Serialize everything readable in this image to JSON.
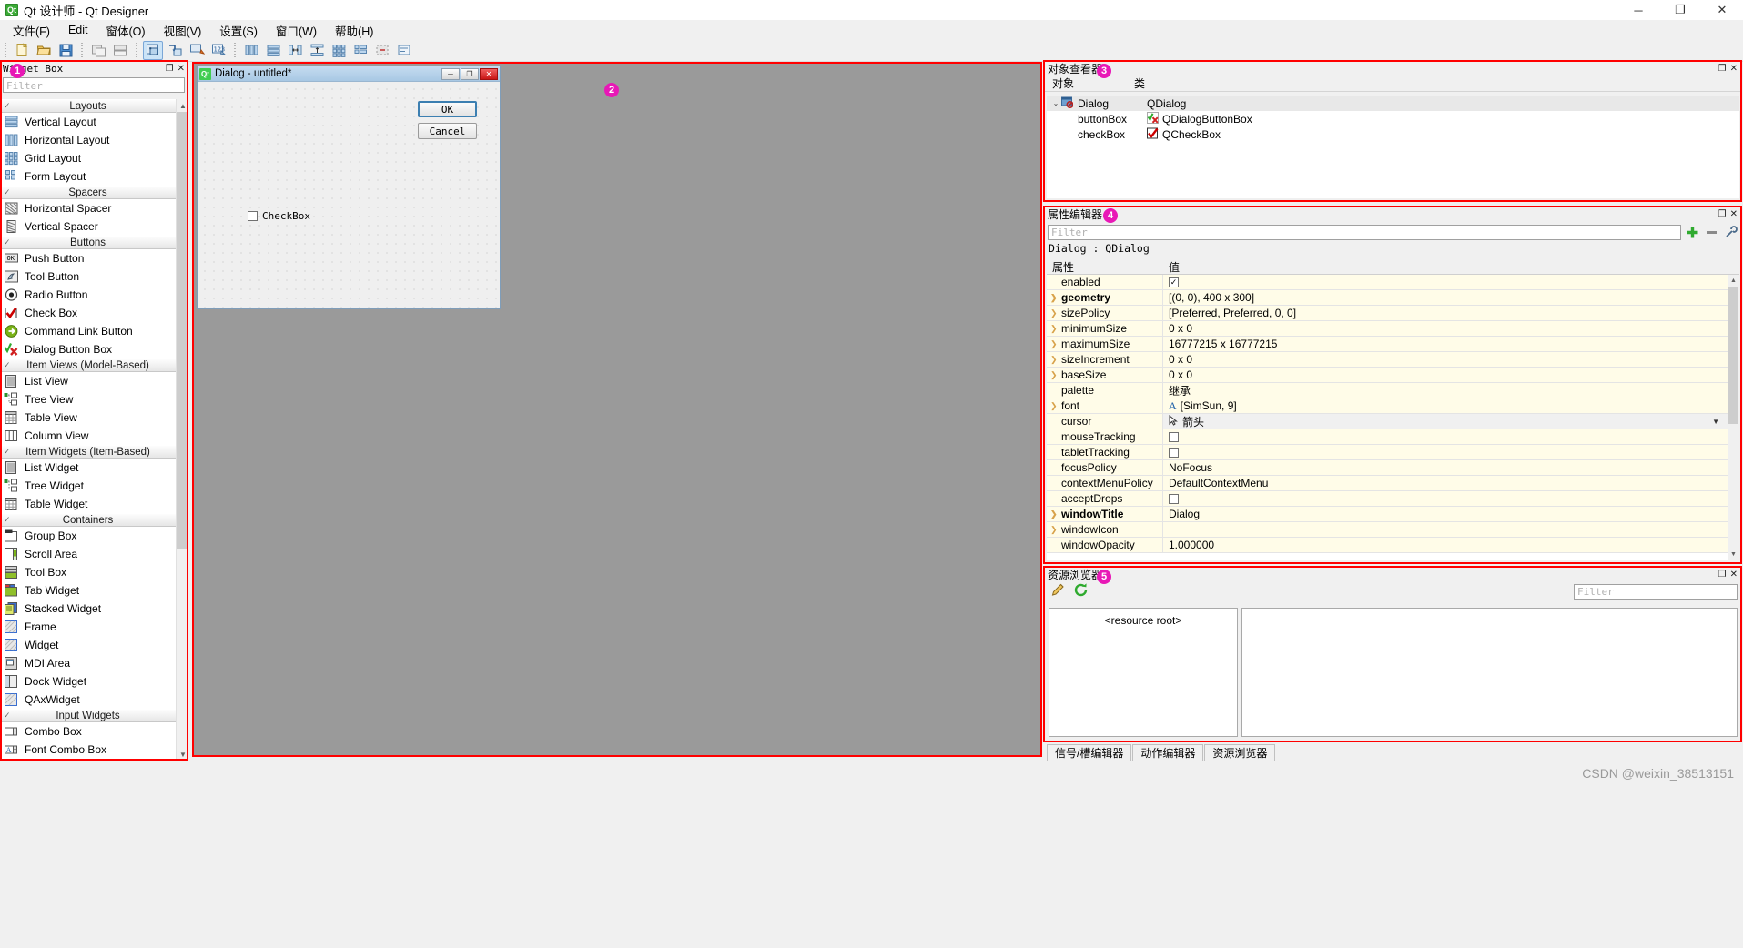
{
  "window": {
    "title": "Qt 设计师 - Qt Designer",
    "app_icon": "Qt",
    "minimize": "─",
    "maximize": "❐",
    "close": "✕"
  },
  "menubar": {
    "items": [
      {
        "label": "文件(F)"
      },
      {
        "label": "Edit"
      },
      {
        "label": "窗体(O)"
      },
      {
        "label": "视图(V)"
      },
      {
        "label": "设置(S)"
      },
      {
        "label": "窗口(W)"
      },
      {
        "label": "帮助(H)"
      }
    ]
  },
  "toolbar": {
    "groups": [
      [
        "new-file-icon",
        "open-folder-icon",
        "save-icon"
      ],
      [
        "form-preview-icon",
        "form-preview2-icon"
      ],
      [
        "edit-widgets-icon",
        "edit-signals-icon",
        "edit-buddies-icon",
        "edit-tab-order-icon"
      ],
      [
        "layout-horizontal-icon",
        "layout-vertical-icon",
        "layout-splitter-h-icon",
        "layout-splitter-v-icon",
        "layout-grid-icon",
        "layout-form-icon",
        "break-layout-icon",
        "adjust-size-icon"
      ]
    ]
  },
  "widget_box": {
    "panel_title": "Widget Box",
    "badge": "1",
    "filter_placeholder": "Filter",
    "float_glyph": "❐",
    "close_glyph": "✕",
    "scroll_up": "▲",
    "scroll_down": "▼",
    "categories": [
      {
        "name": "Layouts",
        "items": [
          {
            "label": "Vertical Layout",
            "icon": "layout-vertical-icon"
          },
          {
            "label": "Horizontal Layout",
            "icon": "layout-horizontal-icon"
          },
          {
            "label": "Grid Layout",
            "icon": "layout-grid-icon"
          },
          {
            "label": "Form Layout",
            "icon": "layout-form-icon"
          }
        ]
      },
      {
        "name": "Spacers",
        "items": [
          {
            "label": "Horizontal Spacer",
            "icon": "spacer-horizontal-icon"
          },
          {
            "label": "Vertical Spacer",
            "icon": "spacer-vertical-icon"
          }
        ]
      },
      {
        "name": "Buttons",
        "items": [
          {
            "label": "Push Button",
            "icon": "push-button-icon"
          },
          {
            "label": "Tool Button",
            "icon": "tool-button-icon"
          },
          {
            "label": "Radio Button",
            "icon": "radio-button-icon"
          },
          {
            "label": "Check Box",
            "icon": "check-box-icon"
          },
          {
            "label": "Command Link Button",
            "icon": "command-link-icon"
          },
          {
            "label": "Dialog Button Box",
            "icon": "dialog-button-box-icon"
          }
        ]
      },
      {
        "name": "Item Views (Model-Based)",
        "items": [
          {
            "label": "List View",
            "icon": "list-view-icon"
          },
          {
            "label": "Tree View",
            "icon": "tree-view-icon"
          },
          {
            "label": "Table View",
            "icon": "table-view-icon"
          },
          {
            "label": "Column View",
            "icon": "column-view-icon"
          }
        ]
      },
      {
        "name": "Item Widgets (Item-Based)",
        "items": [
          {
            "label": "List Widget",
            "icon": "list-widget-icon"
          },
          {
            "label": "Tree Widget",
            "icon": "tree-widget-icon"
          },
          {
            "label": "Table Widget",
            "icon": "table-widget-icon"
          }
        ]
      },
      {
        "name": "Containers",
        "items": [
          {
            "label": "Group Box",
            "icon": "group-box-icon"
          },
          {
            "label": "Scroll Area",
            "icon": "scroll-area-icon"
          },
          {
            "label": "Tool Box",
            "icon": "tool-box-icon"
          },
          {
            "label": "Tab Widget",
            "icon": "tab-widget-icon"
          },
          {
            "label": "Stacked Widget",
            "icon": "stacked-widget-icon"
          },
          {
            "label": "Frame",
            "icon": "frame-icon"
          },
          {
            "label": "Widget",
            "icon": "widget-icon"
          },
          {
            "label": "MDI Area",
            "icon": "mdi-area-icon"
          },
          {
            "label": "Dock Widget",
            "icon": "dock-widget-icon"
          },
          {
            "label": "QAxWidget",
            "icon": "qax-widget-icon"
          }
        ]
      },
      {
        "name": "Input Widgets",
        "items": [
          {
            "label": "Combo Box",
            "icon": "combo-box-icon"
          },
          {
            "label": "Font Combo Box",
            "icon": "font-combo-box-icon"
          }
        ]
      }
    ]
  },
  "canvas": {
    "badge": "2",
    "form": {
      "app_icon": "Qt",
      "title": "Dialog - untitled*",
      "min_glyph": "─",
      "max_glyph": "❐",
      "close_glyph": "✕",
      "ok_button": "OK",
      "cancel_button": "Cancel",
      "checkbox_label": "CheckBox"
    }
  },
  "object_inspector": {
    "panel_title": "对象查看器",
    "badge": "3",
    "float_glyph": "❐",
    "close_glyph": "✕",
    "columns": [
      "对象",
      "类"
    ],
    "rows": [
      {
        "object": "Dialog",
        "class": "QDialog",
        "icon": "dialog-icon",
        "twisty": "⌄",
        "indent": 0,
        "selected": true
      },
      {
        "object": "buttonBox",
        "class": "QDialogButtonBox",
        "icon": "dialog-button-box-icon",
        "twisty": "",
        "indent": 1,
        "selected": false
      },
      {
        "object": "checkBox",
        "class": "QCheckBox",
        "icon": "check-box-icon",
        "twisty": "",
        "indent": 1,
        "selected": false
      }
    ]
  },
  "property_editor": {
    "panel_title": "属性编辑器",
    "badge": "4",
    "float_glyph": "❐",
    "close_glyph": "✕",
    "filter_placeholder": "Filter",
    "add_glyph": "+",
    "remove_glyph": "─",
    "config_glyph": "🔧",
    "object_line": "Dialog : QDialog",
    "columns": [
      "属性",
      "值"
    ],
    "scroll_up": "▲",
    "scroll_down": "▼",
    "rows": [
      {
        "name": "enabled",
        "value": "",
        "twisty": false,
        "bold": false,
        "widget": "checkbox-checked"
      },
      {
        "name": "geometry",
        "value": "[(0, 0), 400 x 300]",
        "twisty": true,
        "bold": true,
        "widget": "text"
      },
      {
        "name": "sizePolicy",
        "value": "[Preferred, Preferred, 0, 0]",
        "twisty": true,
        "bold": false,
        "widget": "text"
      },
      {
        "name": "minimumSize",
        "value": "0 x 0",
        "twisty": true,
        "bold": false,
        "widget": "text"
      },
      {
        "name": "maximumSize",
        "value": "16777215 x 16777215",
        "twisty": true,
        "bold": false,
        "widget": "text"
      },
      {
        "name": "sizeIncrement",
        "value": "0 x 0",
        "twisty": true,
        "bold": false,
        "widget": "text"
      },
      {
        "name": "baseSize",
        "value": "0 x 0",
        "twisty": true,
        "bold": false,
        "widget": "text"
      },
      {
        "name": "palette",
        "value": "继承",
        "twisty": false,
        "bold": false,
        "widget": "text"
      },
      {
        "name": "font",
        "value": "[SimSun, 9]",
        "twisty": true,
        "bold": false,
        "widget": "font"
      },
      {
        "name": "cursor",
        "value": "箭头",
        "twisty": false,
        "bold": false,
        "widget": "combo"
      },
      {
        "name": "mouseTracking",
        "value": "",
        "twisty": false,
        "bold": false,
        "widget": "checkbox"
      },
      {
        "name": "tabletTracking",
        "value": "",
        "twisty": false,
        "bold": false,
        "widget": "checkbox"
      },
      {
        "name": "focusPolicy",
        "value": "NoFocus",
        "twisty": false,
        "bold": false,
        "widget": "text"
      },
      {
        "name": "contextMenuPolicy",
        "value": "DefaultContextMenu",
        "twisty": false,
        "bold": false,
        "widget": "text"
      },
      {
        "name": "acceptDrops",
        "value": "",
        "twisty": false,
        "bold": false,
        "widget": "checkbox"
      },
      {
        "name": "windowTitle",
        "value": "Dialog",
        "twisty": true,
        "bold": true,
        "widget": "text"
      },
      {
        "name": "windowIcon",
        "value": "",
        "twisty": true,
        "bold": false,
        "widget": "text"
      },
      {
        "name": "windowOpacity",
        "value": "1.000000",
        "twisty": false,
        "bold": false,
        "widget": "text"
      }
    ]
  },
  "resource_browser": {
    "panel_title": "资源浏览器",
    "badge": "5",
    "float_glyph": "❐",
    "close_glyph": "✕",
    "edit_icon": "pencil-icon",
    "reload_icon": "reload-icon",
    "filter_placeholder": "Filter",
    "tree_root": "<resource root>"
  },
  "bottom_tabs": {
    "items": [
      {
        "label": "信号/槽编辑器"
      },
      {
        "label": "动作编辑器"
      },
      {
        "label": "资源浏览器"
      }
    ]
  },
  "watermark": {
    "text": "CSDN @weixin_38513151"
  },
  "colors": {
    "annotation": "#ff0000",
    "badge": "#e818b6",
    "canvas_bg": "#9a9a9a",
    "property_row": "#fffce8",
    "titlebar_accent": "#a8c8e4"
  }
}
